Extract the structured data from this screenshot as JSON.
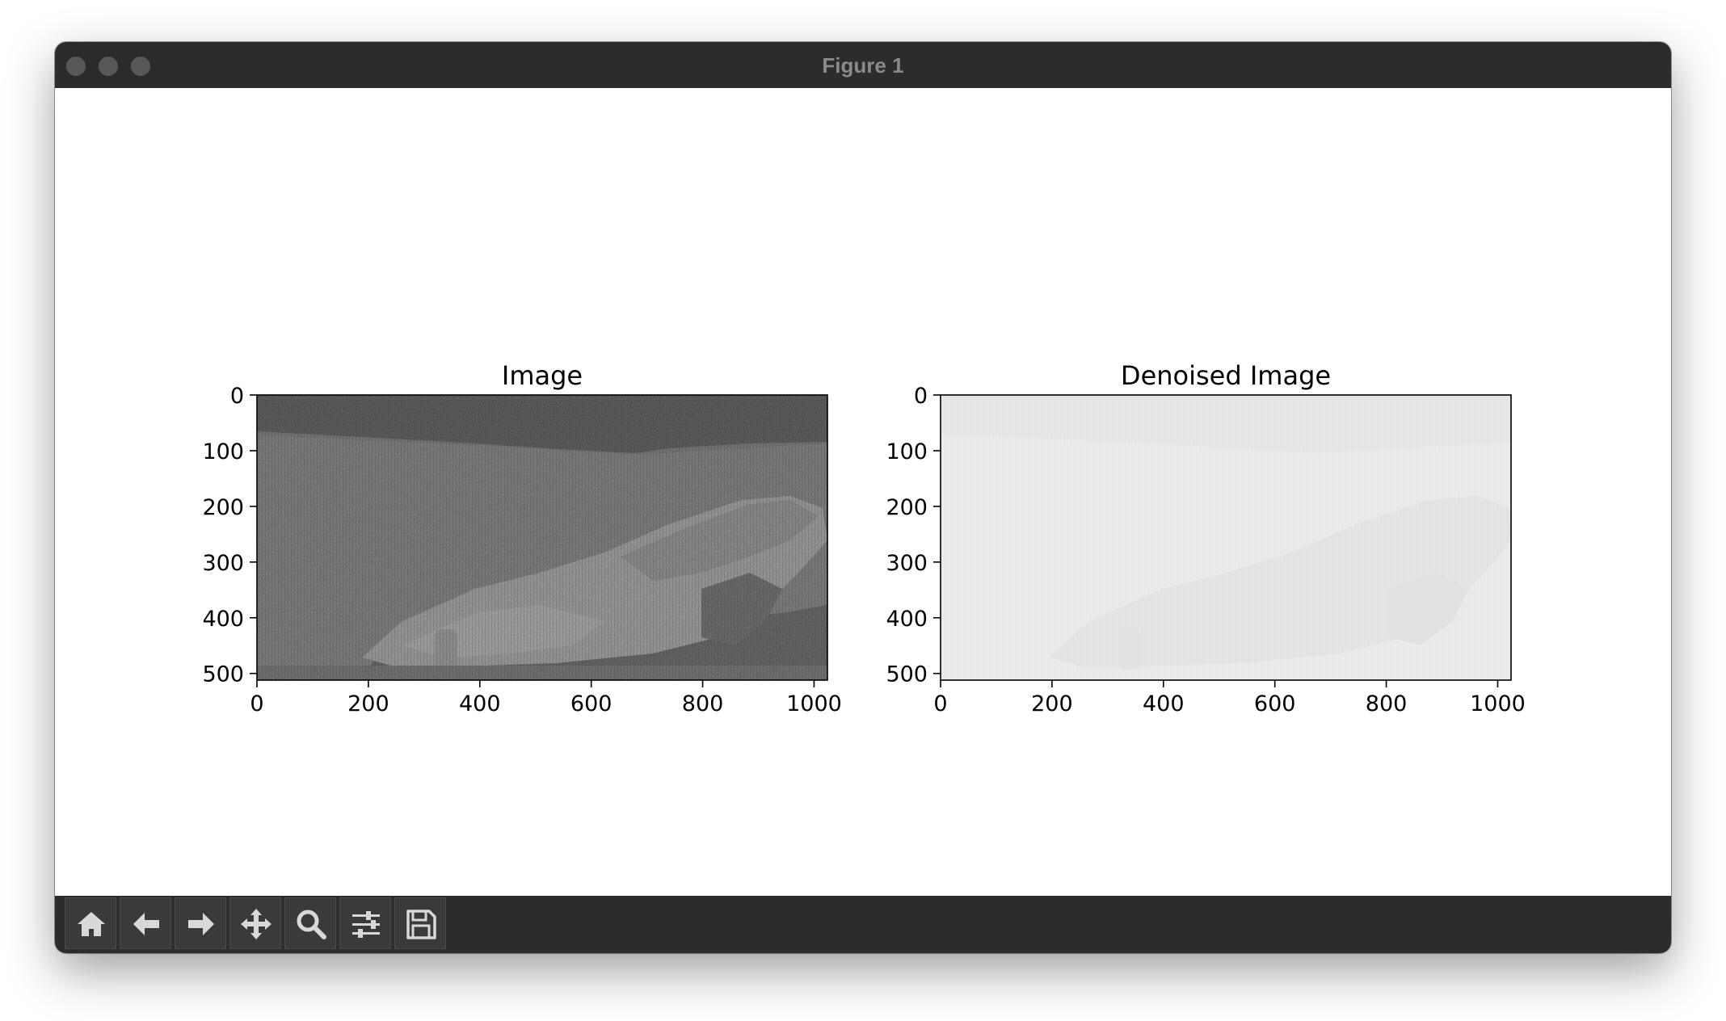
{
  "window": {
    "title": "Figure 1"
  },
  "toolbar": {
    "buttons": [
      {
        "icon": "home-icon"
      },
      {
        "icon": "back-arrow-icon"
      },
      {
        "icon": "forward-arrow-icon"
      },
      {
        "icon": "pan-move-icon"
      },
      {
        "icon": "zoom-magnifier-icon"
      },
      {
        "icon": "configure-subplots-icon"
      },
      {
        "icon": "save-floppy-icon"
      }
    ]
  },
  "colors": {
    "titlebar": "#2c2d2b",
    "toolbar": "#2c2d2b",
    "traffic_light": "#575856",
    "original_image_tone": "#6a6a6a",
    "denoised_image_tone": "#e9e9e9"
  },
  "chart_data": [
    {
      "type": "image",
      "title": "Image",
      "xlim": [
        0,
        1024
      ],
      "ylim": [
        512,
        0
      ],
      "xticks": [
        "0",
        "200",
        "400",
        "600",
        "800",
        "1000"
      ],
      "yticks": [
        "0",
        "100",
        "200",
        "300",
        "400",
        "500"
      ],
      "x_tick_values": [
        0,
        200,
        400,
        600,
        800,
        1000
      ],
      "y_tick_values": [
        0,
        100,
        200,
        300,
        400,
        500
      ]
    },
    {
      "type": "image",
      "title": "Denoised Image",
      "xlim": [
        0,
        1024
      ],
      "ylim": [
        512,
        0
      ],
      "xticks": [
        "0",
        "200",
        "400",
        "600",
        "800",
        "1000"
      ],
      "yticks": [
        "0",
        "100",
        "200",
        "300",
        "400",
        "500"
      ],
      "x_tick_values": [
        0,
        200,
        400,
        600,
        800,
        1000
      ],
      "y_tick_values": [
        0,
        100,
        200,
        300,
        400,
        500
      ]
    }
  ]
}
